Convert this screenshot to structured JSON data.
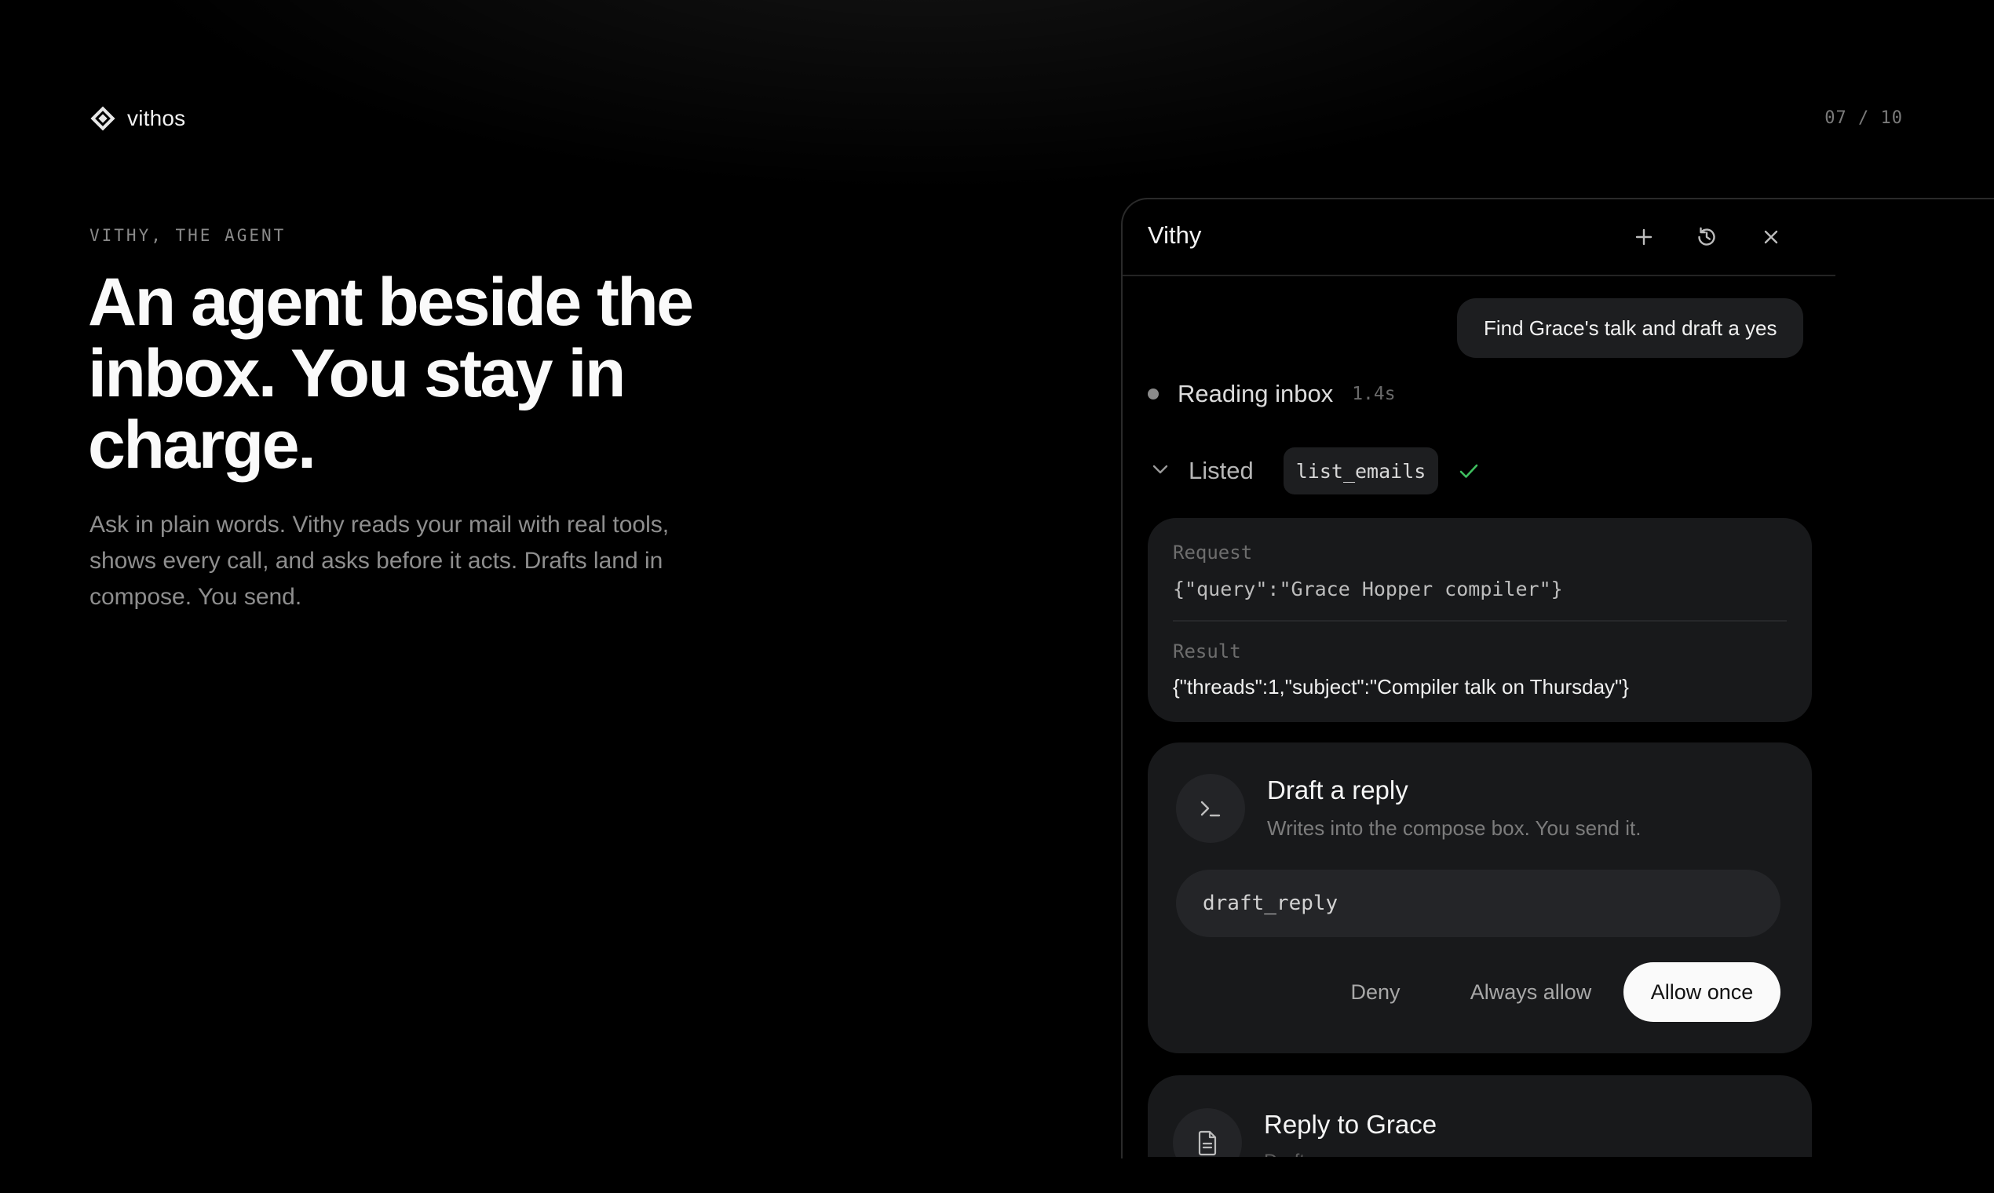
{
  "brand": {
    "name": "vithos",
    "icon": "vithos-logo"
  },
  "pager": "07 / 10",
  "hero": {
    "eyebrow": "VITHY, THE AGENT",
    "headline_lines": [
      "An agent beside the",
      "inbox. You stay in",
      "charge."
    ],
    "lede_lines": [
      "Ask in plain words. Vithy reads your mail with real tools,",
      "shows every call, and asks before it acts. Drafts land in",
      "compose. You send."
    ]
  },
  "panel": {
    "title": "Vithy",
    "header_icons": [
      "plus-icon",
      "history-icon",
      "close-icon"
    ],
    "user_message": "Find Grace's talk and draft a yes",
    "status": {
      "text": "Reading inbox",
      "time": "1.4s"
    },
    "tool_call": {
      "label": "Listed",
      "tool": "list_emails",
      "request_label": "Request",
      "request": "{\"query\":\"Grace Hopper compiler\"}",
      "result_label": "Result",
      "result": "{\"threads\":1,\"subject\":\"Compiler talk on Thursday\"}"
    },
    "permission": {
      "title": "Draft a reply",
      "subtitle": "Writes into the compose box. You send it.",
      "tool": "draft_reply",
      "deny": "Deny",
      "always_allow": "Always allow",
      "allow_once": "Allow once"
    },
    "draft": {
      "title": "Reply to Grace",
      "subtitle": "Draft"
    }
  },
  "colors": {
    "background": "#000000",
    "card": "#18191b",
    "success": "#3fbf5f",
    "primary_button": "#fafafa"
  }
}
